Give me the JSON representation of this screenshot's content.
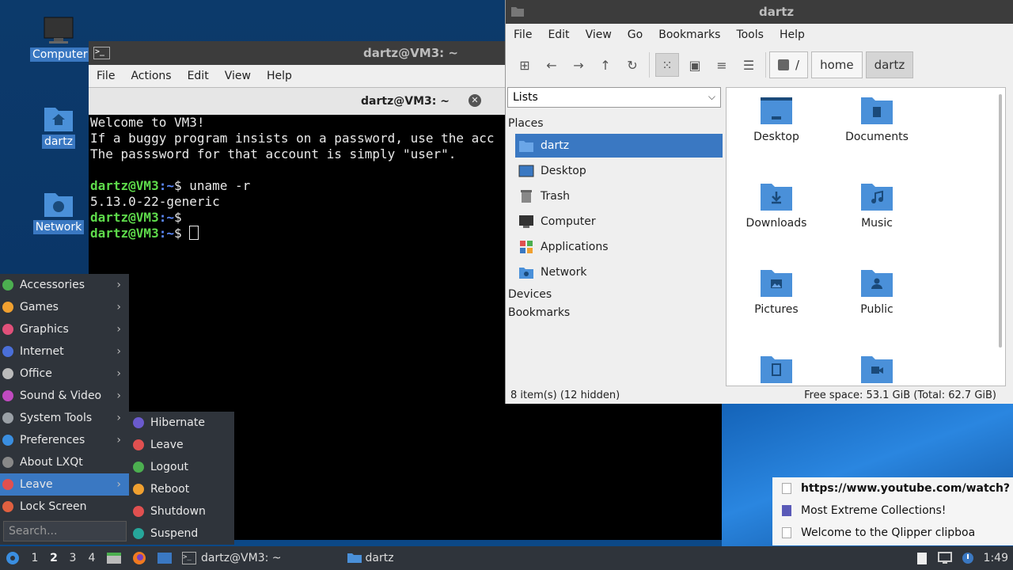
{
  "desktop": {
    "icons": [
      {
        "label": "Computer"
      },
      {
        "label": "dartz"
      },
      {
        "label": "Network"
      }
    ]
  },
  "terminal": {
    "title": "dartz@VM3: ~",
    "menu": [
      "File",
      "Actions",
      "Edit",
      "View",
      "Help"
    ],
    "tab_label": "dartz@VM3: ~",
    "lines": [
      "Welcome to VM3!",
      "If a buggy program insists on a password, use the acc",
      "The passsword for that account is simply \"user\"."
    ],
    "prompt_user": "dartz@VM3",
    "prompt_path": ":~",
    "prompt_sym": "$ ",
    "cmd1": "uname -r",
    "out1": "5.13.0-22-generic"
  },
  "filemanager": {
    "title": "dartz",
    "menu": [
      "File",
      "Edit",
      "View",
      "Go",
      "Bookmarks",
      "Tools",
      "Help"
    ],
    "path": [
      "/",
      "home",
      "dartz"
    ],
    "view_select": "Lists",
    "sections": {
      "places": "Places",
      "devices": "Devices",
      "bookmarks": "Bookmarks"
    },
    "places": [
      "dartz",
      "Desktop",
      "Trash",
      "Computer",
      "Applications",
      "Network"
    ],
    "items": [
      "Desktop",
      "Documents",
      "Downloads",
      "Music",
      "Pictures",
      "Public"
    ],
    "status_left": "8 item(s) (12 hidden)",
    "status_right": "Free space: 53.1 GiB (Total: 62.7 GiB)"
  },
  "appmenu": {
    "items": [
      {
        "label": "Accessories",
        "color": "#4caf50"
      },
      {
        "label": "Games",
        "color": "#f0a030"
      },
      {
        "label": "Graphics",
        "color": "#e0507a"
      },
      {
        "label": "Internet",
        "color": "#4a6fd8"
      },
      {
        "label": "Office",
        "color": "#bbbbbb"
      },
      {
        "label": "Sound & Video",
        "color": "#c04ac0"
      },
      {
        "label": "System Tools",
        "color": "#9aa0a6"
      },
      {
        "label": "Preferences",
        "color": "#3a8ee0"
      },
      {
        "label": "About LXQt",
        "color": "#888888"
      },
      {
        "label": "Leave",
        "color": "#e05050"
      },
      {
        "label": "Lock Screen",
        "color": "#e06040"
      }
    ],
    "search_placeholder": "Search...",
    "leave_submenu": [
      {
        "label": "Hibernate",
        "color": "#6a5acd"
      },
      {
        "label": "Leave",
        "color": "#e05050"
      },
      {
        "label": "Logout",
        "color": "#4caf50"
      },
      {
        "label": "Reboot",
        "color": "#f0a030"
      },
      {
        "label": "Shutdown",
        "color": "#e05050"
      },
      {
        "label": "Suspend",
        "color": "#26a69a"
      }
    ]
  },
  "notification": {
    "rows": [
      "https://www.youtube.com/watch?",
      "Most Extreme Collections!",
      "Welcome to the Qlipper clipboa"
    ]
  },
  "taskbar": {
    "workspaces": [
      "1",
      "2",
      "3",
      "4"
    ],
    "tasks": [
      "dartz@VM3: ~",
      "dartz"
    ],
    "clock": "1:49"
  }
}
